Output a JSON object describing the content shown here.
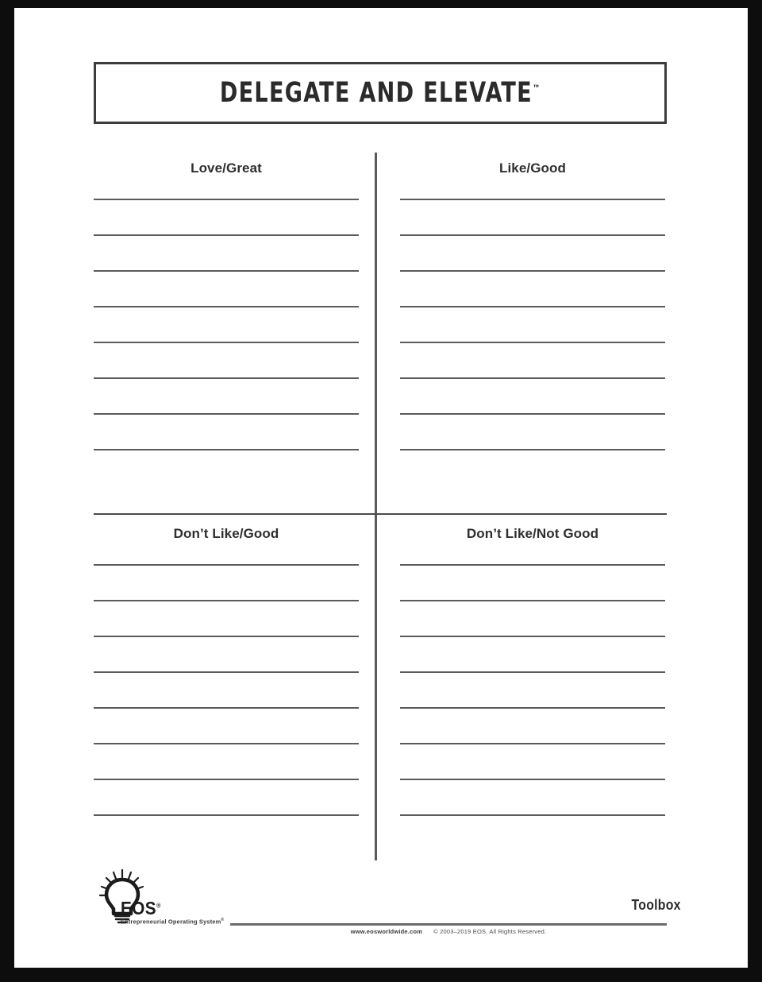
{
  "document": {
    "title": "DELEGATE AND ELEVATE",
    "title_trademark": "™"
  },
  "quadrants": [
    {
      "id": "love-great",
      "label": "Love/Great",
      "position": "top-left",
      "line_count": 8
    },
    {
      "id": "like-good",
      "label": "Like/Good",
      "position": "top-right",
      "line_count": 8
    },
    {
      "id": "dont-like-good",
      "label": "Don’t Like/Good",
      "position": "bottom-left",
      "line_count": 8
    },
    {
      "id": "dont-like-not-good",
      "label": "Don’t Like/Not Good",
      "position": "bottom-right",
      "line_count": 8
    }
  ],
  "footer": {
    "logo_name": "EOS",
    "logo_registered": "®",
    "logo_tagline": "Entrepreneurial Operating System",
    "logo_tagline_registered": "®",
    "toolbox_label": "Toolbox",
    "website": "www.eosworldwide.com",
    "copyright": "© 2003–2019 EOS.   All Rights Reserved."
  },
  "colors": {
    "page_background": "#ffffff",
    "frame": "#0d0d0d",
    "rule": "#5b5b5b",
    "divider": "#5a5a5a",
    "text": "#2e2e2e",
    "title_border": "#3c3c3c"
  }
}
